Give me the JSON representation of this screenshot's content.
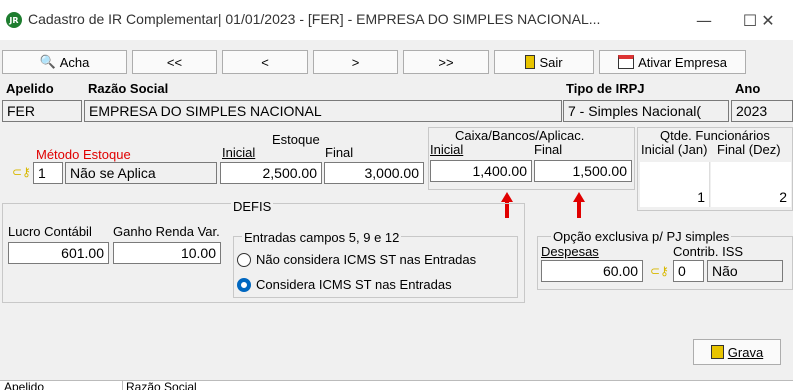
{
  "window": {
    "title": "Cadastro de IR Complementar|  01/01/2023 - [FER] - EMPRESA DO SIMPLES NACIONAL...",
    "minimize_symbol": "—",
    "maximize_symbol": "☐",
    "close_symbol": "✕"
  },
  "toolbar": {
    "acha_label": "Acha",
    "first_label": "<<",
    "prev_label": "<",
    "next_label": ">",
    "last_label": ">>",
    "sair_label": "Sair",
    "ativar_label": "Ativar Empresa"
  },
  "header": {
    "apelido_label": "Apelido",
    "razao_label": "Razão Social",
    "tipo_label": "Tipo de IRPJ",
    "ano_label": "Ano",
    "apelido_value": "FER",
    "razao_value": "EMPRESA DO SIMPLES NACIONAL",
    "tipo_value": "7 - Simples Nacional(",
    "ano_value": "2023"
  },
  "estoque": {
    "metodo_label": "Método Estoque",
    "estoque_label": "Estoque",
    "inicial_label": "Inicial",
    "final_label": "Final",
    "metodo_code": "1",
    "metodo_desc": "Não se Aplica",
    "inicial_value": "2,500.00",
    "final_value": "3,000.00"
  },
  "caixa": {
    "title": "Caixa/Bancos/Aplicac.",
    "inicial_label": "Inicial",
    "final_label": "Final",
    "inicial_value": "1,400.00",
    "final_value": "1,500.00"
  },
  "funcionarios": {
    "title": "Qtde. Funcionários",
    "inicial_label": "Inicial (Jan)",
    "final_label": "Final (Dez)",
    "inicial_value": "1",
    "final_value": "2"
  },
  "defis": {
    "title": "DEFIS",
    "lucro_label": "Lucro Contábil",
    "ganho_label": "Ganho Renda Var.",
    "lucro_value": "601.00",
    "ganho_value": "10.00",
    "entradas_title": "Entradas campos 5, 9 e 12",
    "option1": "Não considera ICMS ST nas Entradas",
    "option2": "Considera ICMS ST nas Entradas",
    "selected": 2
  },
  "pj_simples": {
    "title": "Opção exclusiva p/ PJ simples",
    "despesas_label": "Despesas",
    "contrib_label": "Contrib. ISS",
    "despesas_value": "60.00",
    "contrib_code": "0",
    "contrib_desc": "Não"
  },
  "grava_label": "Grava",
  "footer": {
    "col1": "Apelido",
    "col2": "Razão Social"
  },
  "colors": {
    "accent_radio": "#0067c0",
    "arrow_red": "#e00000",
    "metodo_label_color": "#e00000"
  }
}
